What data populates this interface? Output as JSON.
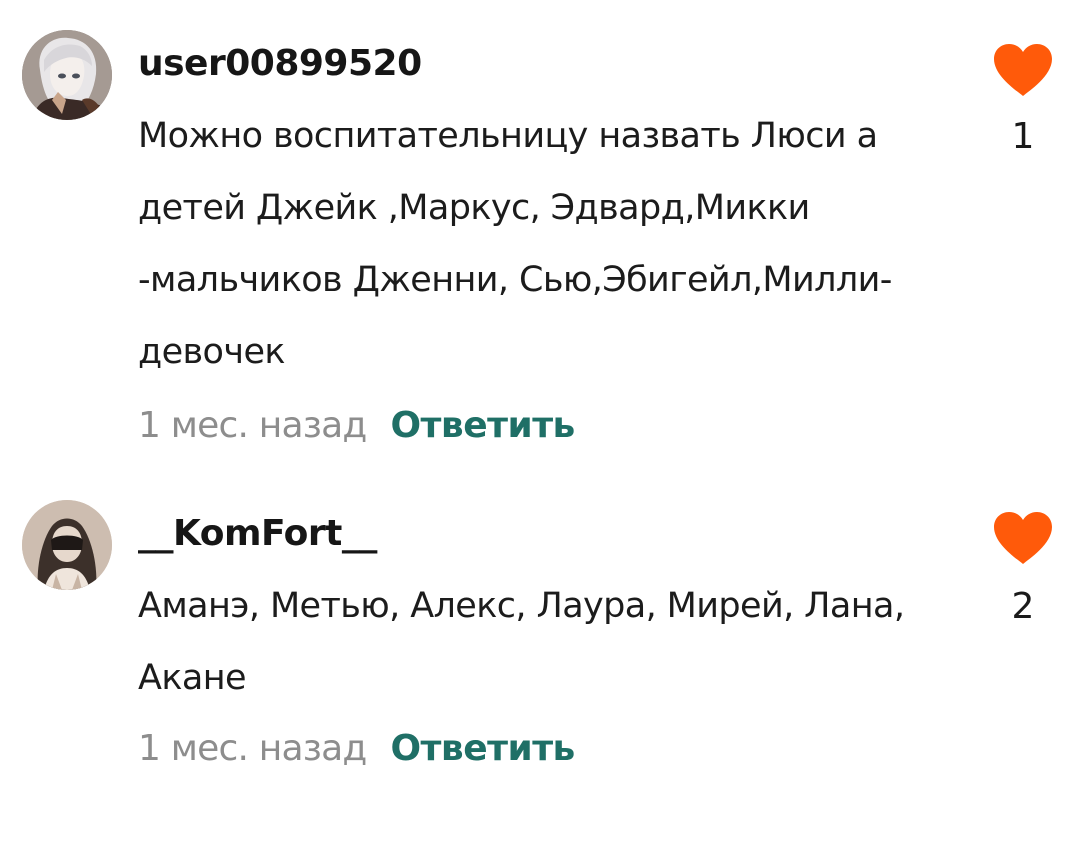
{
  "comments": [
    {
      "username": "user00899520",
      "text": "Можно воспитательницу назвать Люси а детей Джейк ,Маркус, Эдвард,Микки -мальчиков Дженни, Сью,Эбигейл,Милли-девочек",
      "time": "1 мес. назад",
      "reply_label": "Ответить",
      "likes": "1",
      "avatar": "avatar-white-haired-character"
    },
    {
      "username": "__KomFort__",
      "text": "Аманэ, Метью, Алекс, Лаура, Мирей, Лана, Акане",
      "time": "1 мес. назад",
      "reply_label": "Ответить",
      "likes": "2",
      "avatar": "avatar-masked-character"
    }
  ],
  "colors": {
    "heart": "#ff5a0a",
    "reply": "#1f6f66",
    "time": "#8d8d8d"
  },
  "icons": {
    "like": "heart-icon"
  }
}
